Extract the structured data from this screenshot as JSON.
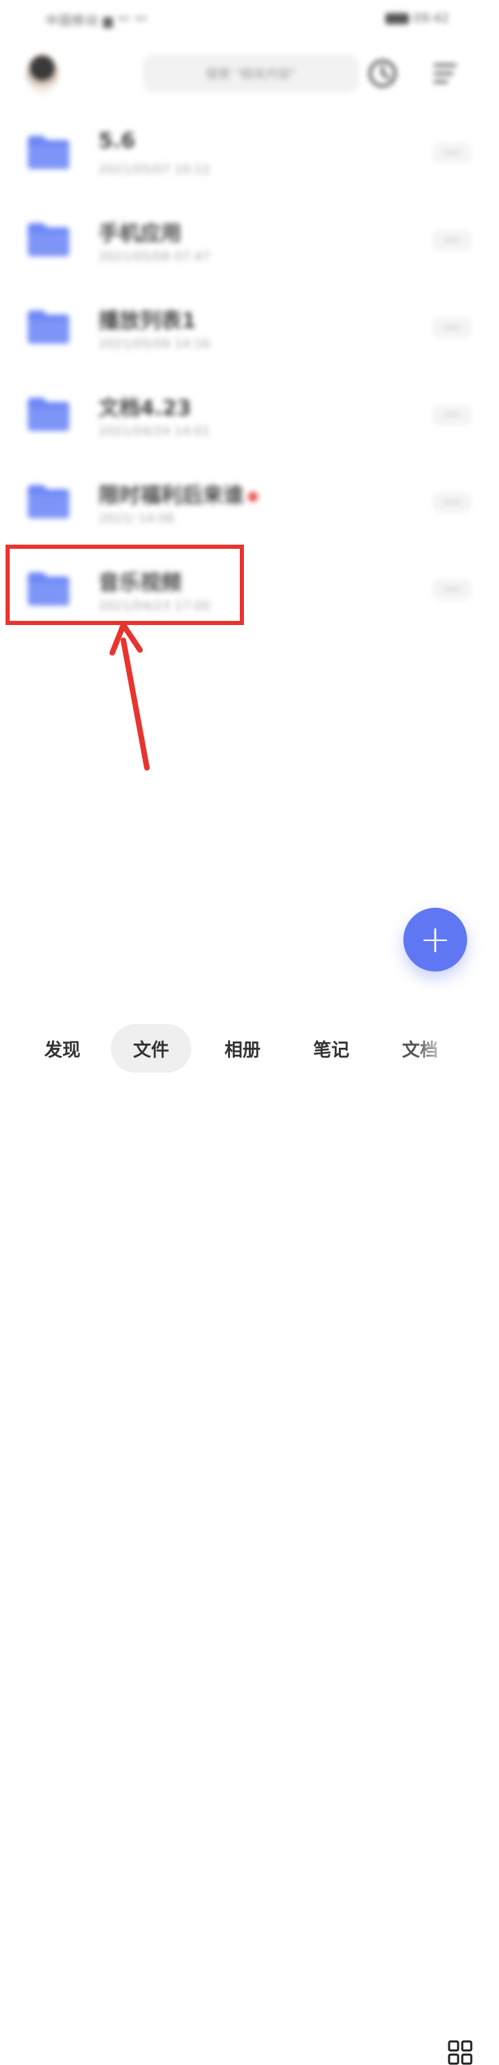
{
  "status_bar": {
    "left_text": "中国移动 ▆ ⁴ᴳ ⁴ᴳ",
    "right_text": "09:42"
  },
  "header": {
    "search_placeholder": "搜索 \"相关内容\"",
    "clock_icon": "clock-icon",
    "menu_icon": "menu-icon"
  },
  "files": [
    {
      "name": "5.6",
      "date": "2021/05/07 10:12",
      "badge": false
    },
    {
      "name": "手机应用",
      "date": "2021/05/08 07:47",
      "badge": false
    },
    {
      "name": "播放列表1",
      "date": "2021/05/09 14:16",
      "badge": false
    },
    {
      "name": "文档4.23",
      "date": "2021/04/24 14:01",
      "badge": false
    },
    {
      "name": "限时福利后来谁",
      "date": "2021/ 14:06",
      "badge": true
    },
    {
      "name": "音乐视频",
      "date": "2021/04/23 17:00",
      "badge": false
    }
  ],
  "fab": {
    "label": "+"
  },
  "bottom_nav": {
    "items": [
      {
        "label": "发现"
      },
      {
        "label": "文件"
      },
      {
        "label": "相册"
      },
      {
        "label": "笔记"
      },
      {
        "label": "文档"
      }
    ],
    "grid_icon": "grid-icon"
  },
  "colors": {
    "accent": "#6077f4",
    "folder": "#6c86f5",
    "annotation_red": "#e8342e"
  }
}
